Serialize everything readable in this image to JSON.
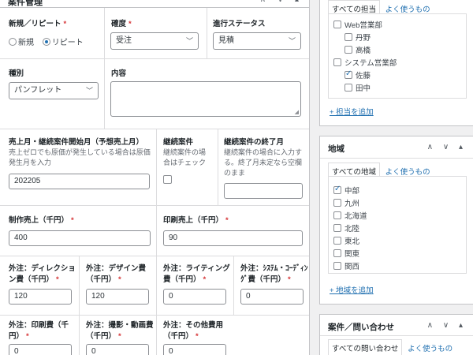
{
  "main": {
    "title": "案件管理",
    "header_controls": "∧ ∨ ▴",
    "fields": {
      "type": {
        "label": "新規／リピート",
        "options": [
          "新規",
          "リピート"
        ],
        "selected": "リピート"
      },
      "certainty": {
        "label": "確度",
        "value": "受注"
      },
      "progress": {
        "label": "進行ステータス",
        "value": "見積"
      },
      "kind": {
        "label": "種別",
        "value": "パンフレット"
      },
      "content": {
        "label": "内容",
        "value": ""
      },
      "sales_start": {
        "label": "売上月・継続案件開始月（予想売上月）",
        "desc": "売上ゼロでも原価が発生している場合は原価発生月を入力",
        "value": "202205"
      },
      "continuing": {
        "label": "継続案件",
        "desc": "継続案件の場合はチェック"
      },
      "continuing_end": {
        "label": "継続案件の終了月",
        "desc": "継続案件の場合に入力する。終了月未定なら空欄のまま",
        "value": ""
      },
      "production_sales": {
        "label": "制作売上（千円）",
        "value": "400"
      },
      "print_sales": {
        "label": "印刷売上（千円）",
        "value": "90"
      },
      "out_direction": {
        "label1": "外注：ディレクショ",
        "label2": "ン費（千円）",
        "value": "120"
      },
      "out_design": {
        "label1": "外注：デザイン費",
        "label2": "（千円）",
        "value": "120"
      },
      "out_writing": {
        "label1": "外注：ライティング",
        "label2": "費（千円）",
        "value": "0"
      },
      "out_system": {
        "label1": "外注：ｼｽﾃﾑ・ｺｰﾃﾞｨﾝ",
        "label2": "ｸﾞ費（千円）",
        "value": "0"
      },
      "out_print": {
        "label1": "外注：印刷費（千",
        "label2": "円）",
        "value": "0"
      },
      "out_photo": {
        "label1": "外注：撮影・動画費",
        "label2": "（千円）",
        "value": "0"
      },
      "out_other": {
        "label1": "外注：その他費用",
        "label2": "（千円）",
        "value": "0"
      }
    }
  },
  "staff_box": {
    "tab_all": "すべての担当",
    "tab_common": "よく使うもの",
    "items": [
      {
        "label": "Web営業部",
        "checked": false,
        "level": 0
      },
      {
        "label": "丹野",
        "checked": false,
        "level": 1
      },
      {
        "label": "高橋",
        "checked": false,
        "level": 1
      },
      {
        "label": "システム営業部",
        "checked": false,
        "level": 0
      },
      {
        "label": "佐藤",
        "checked": true,
        "level": 1
      },
      {
        "label": "田中",
        "checked": false,
        "level": 1
      }
    ],
    "add_link": "+ 担当を追加"
  },
  "region_box": {
    "title": "地域",
    "controls": "∧ ∨ ▴",
    "tab_all": "すべての地域",
    "tab_common": "よく使うもの",
    "items": [
      {
        "label": "中部",
        "checked": true
      },
      {
        "label": "九州",
        "checked": false
      },
      {
        "label": "北海道",
        "checked": false
      },
      {
        "label": "北陸",
        "checked": false
      },
      {
        "label": "東北",
        "checked": false
      },
      {
        "label": "関東",
        "checked": false
      },
      {
        "label": "関西",
        "checked": false
      }
    ],
    "add_link": "+ 地域を追加"
  },
  "inquiry_box": {
    "title": "案件／問い合わせ",
    "controls": "∧ ∨ ▴",
    "tab_all": "すべての問い合わせ",
    "tab_common": "よく使うもの"
  },
  "colors": {
    "accent": "#2271b1",
    "required": "#d63638",
    "border": "#8c8f94"
  }
}
